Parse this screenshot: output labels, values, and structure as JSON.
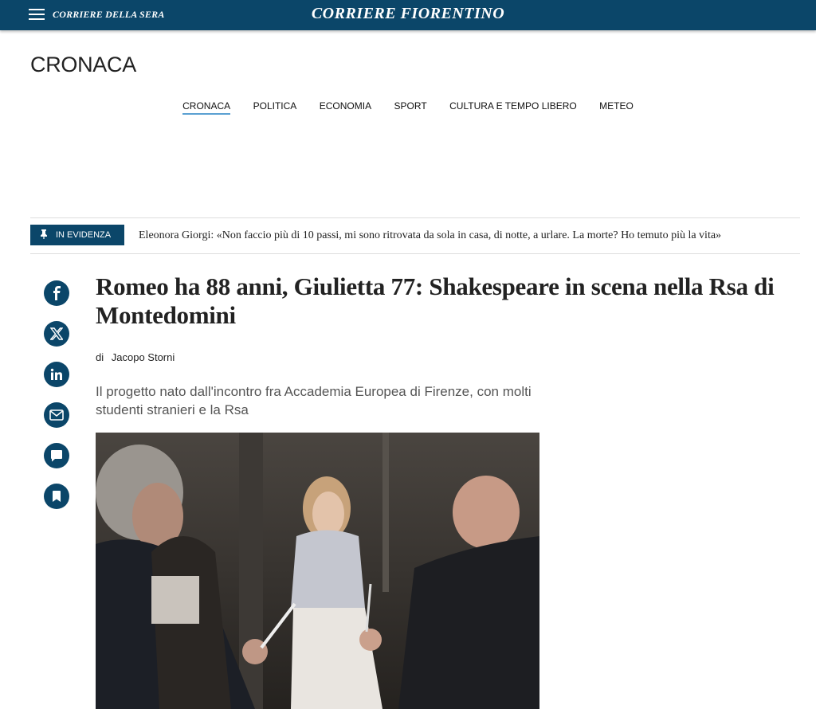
{
  "header": {
    "parent_brand": "Corriere della Sera",
    "brand": "Corriere Fiorentino"
  },
  "section": {
    "title": "CRONACA"
  },
  "nav": {
    "items": [
      {
        "label": "CRONACA",
        "active": true
      },
      {
        "label": "POLITICA",
        "active": false
      },
      {
        "label": "ECONOMIA",
        "active": false
      },
      {
        "label": "SPORT",
        "active": false
      },
      {
        "label": "CULTURA E TEMPO LIBERO",
        "active": false
      },
      {
        "label": "METEO",
        "active": false
      }
    ]
  },
  "evidenza": {
    "label": "IN EVIDENZA",
    "text": "Eleonora Giorgi: «Non faccio più di 10 passi, mi sono ritrovata da sola in casa, di notte, a urlare.  La morte? Ho temuto più la vita»"
  },
  "social": {
    "icons": [
      "facebook-icon",
      "x-icon",
      "linkedin-icon",
      "email-icon",
      "comment-icon",
      "bookmark-icon"
    ]
  },
  "article": {
    "headline": "Romeo ha 88 anni, Giulietta 77: Shakespeare in scena nella Rsa di Montedomini",
    "byline_prefix": "di",
    "author": "Jacopo Storni",
    "subtitle": "Il progetto nato dall'incontro fra Accademia Europea di Firenze, con molti studenti stranieri e la Rsa"
  },
  "colors": {
    "brand_blue": "#0b4669",
    "nav_active_underline": "#5aa0d2"
  }
}
